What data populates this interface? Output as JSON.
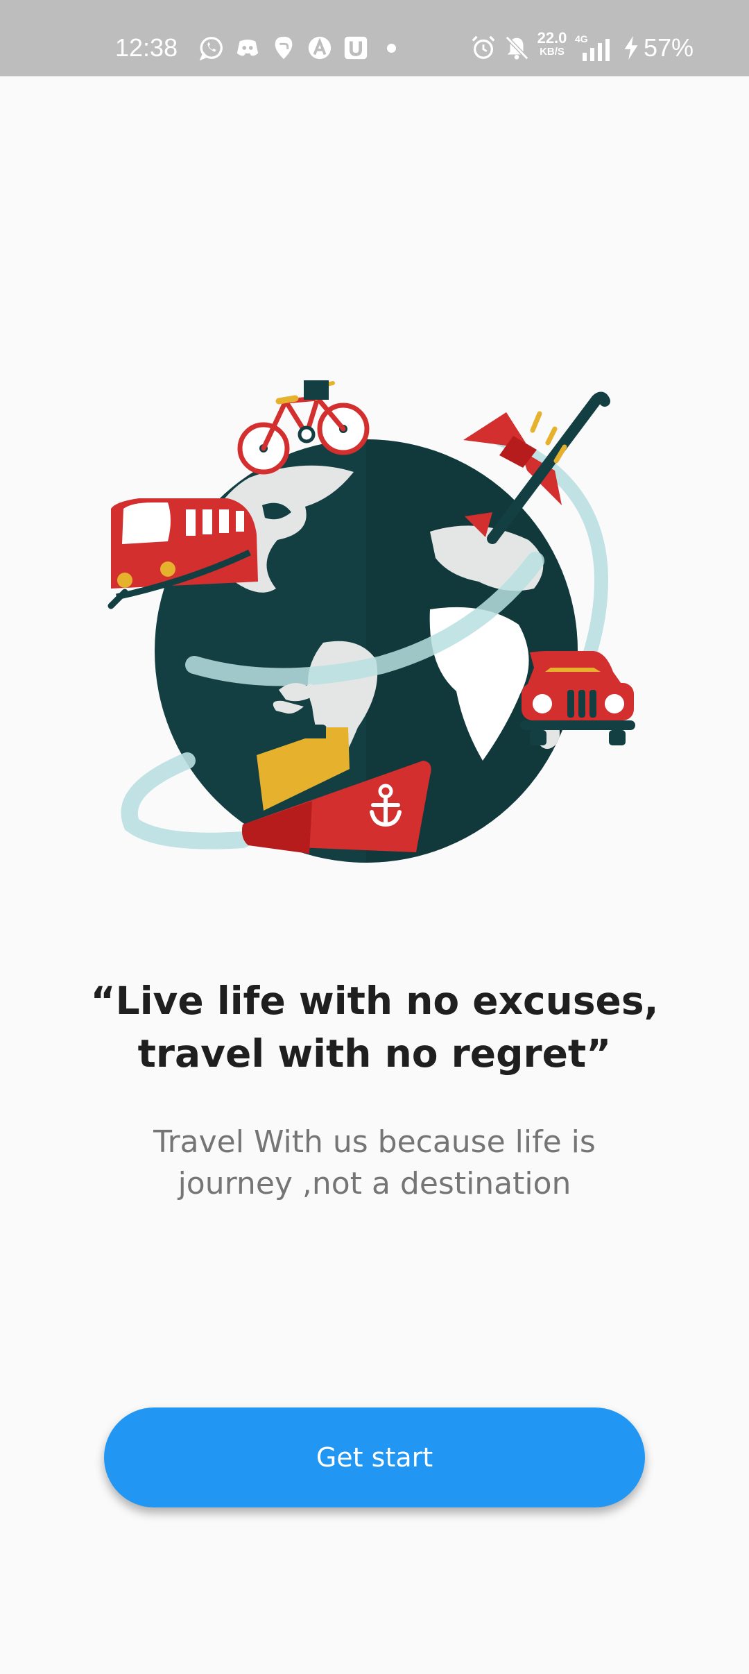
{
  "status_bar": {
    "time": "12:38",
    "net_speed": "22.0",
    "net_speed_unit": "KB/S",
    "network_type": "4G",
    "battery": "57%",
    "notification_icons": [
      "whatsapp-icon",
      "discord-icon",
      "swiggy-icon",
      "arc-icon",
      "u-app-icon"
    ],
    "system_icons": [
      "alarm-icon",
      "muted-bell-icon",
      "signal-icon",
      "charging-icon"
    ]
  },
  "illustration": {
    "name": "travel-globe-illustration",
    "icons": [
      "globe-icon",
      "bicycle-icon",
      "train-icon",
      "airplane-icon",
      "car-icon",
      "ship-icon"
    ]
  },
  "content": {
    "quote": "“Live life with no excuses, travel with no regret”",
    "subtitle": "Travel With us because life is journey ,not a destination"
  },
  "actions": {
    "get_started_label": "Get start"
  },
  "colors": {
    "primary": "#2196f3",
    "status_bar": "#bdbdbd",
    "background": "#fafafa",
    "globe_dark": "#143f42",
    "accent_red": "#d32f2f",
    "accent_yellow": "#e6b12d",
    "swoosh": "#b9dfe1"
  }
}
